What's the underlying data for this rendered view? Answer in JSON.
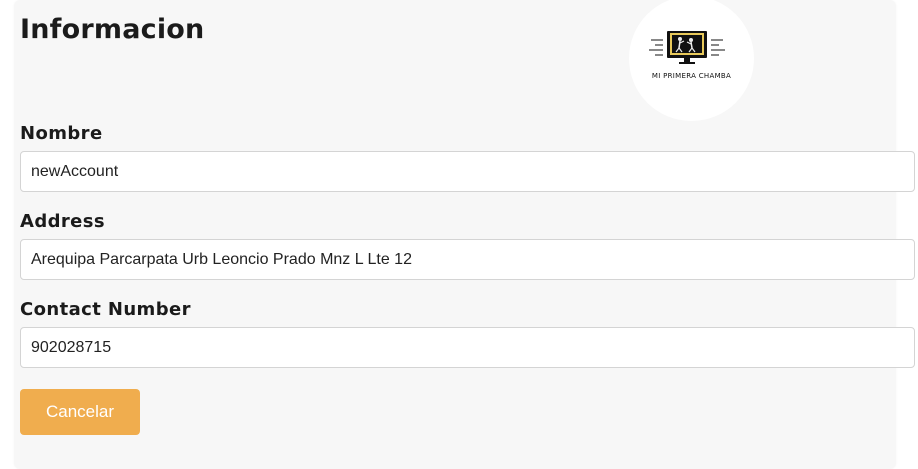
{
  "header": {
    "title": "Informacion",
    "logo_text": "MI PRIMERA CHAMBA"
  },
  "form": {
    "name_label": "Nombre",
    "name_value": "newAccount",
    "address_label": "Address",
    "address_value": "Arequipa Parcarpata Urb Leoncio Prado Mnz L Lte 12",
    "contact_label": "Contact Number",
    "contact_value": "902028715"
  },
  "actions": {
    "cancel_label": "Cancelar"
  },
  "colors": {
    "accent": "#f0ad4e",
    "card_background": "#f7f7f7"
  }
}
